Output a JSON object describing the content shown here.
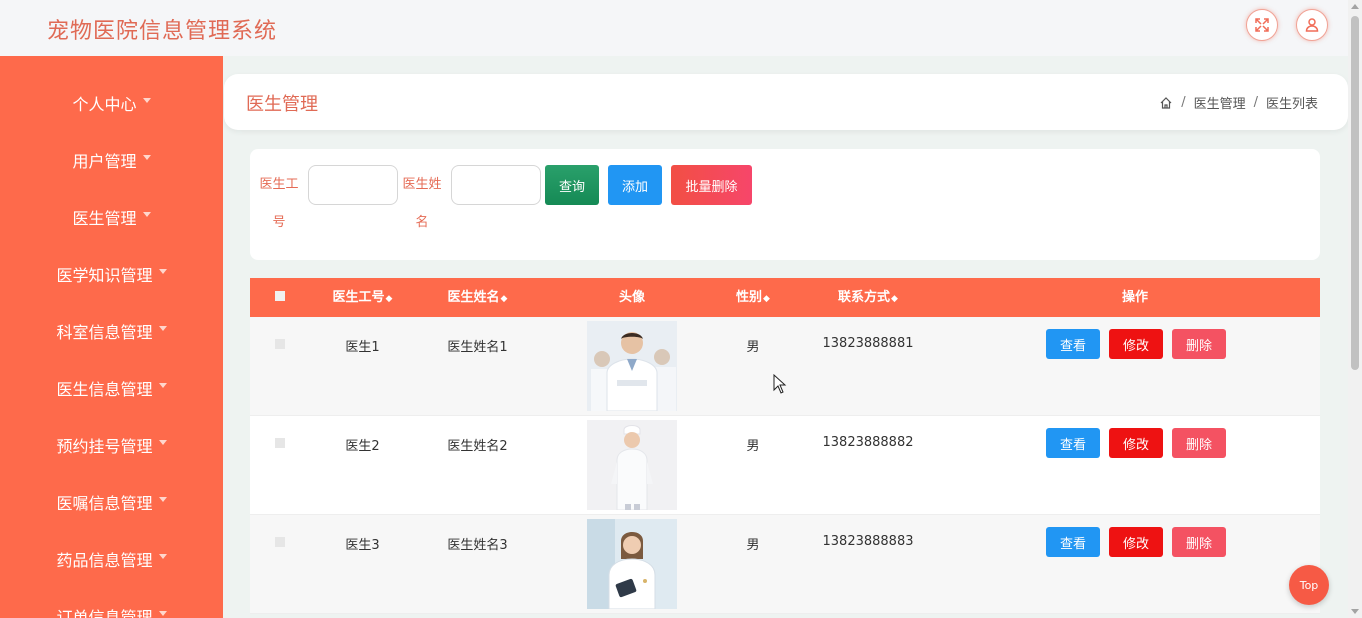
{
  "app": {
    "title": "宠物医院信息管理系统"
  },
  "topbar": {
    "fullscreen_icon": "fullscreen-icon",
    "user_icon": "user-icon"
  },
  "sidebar": {
    "items": [
      {
        "label": "个人中心"
      },
      {
        "label": "用户管理"
      },
      {
        "label": "医生管理"
      },
      {
        "label": "医学知识管理"
      },
      {
        "label": "科室信息管理"
      },
      {
        "label": "医生信息管理"
      },
      {
        "label": "预约挂号管理"
      },
      {
        "label": "医嘱信息管理"
      },
      {
        "label": "药品信息管理"
      },
      {
        "label": "订单信息管理"
      }
    ]
  },
  "header": {
    "title": "医生管理",
    "breadcrumb": [
      "医生管理",
      "医生列表"
    ],
    "breadcrumb_sep": "/"
  },
  "search": {
    "field1_label": "医生工号",
    "field1_value": "",
    "field2_label": "医生姓名",
    "field2_value": "",
    "query_label": "查询",
    "add_label": "添加",
    "bulk_delete_label": "批量删除"
  },
  "table": {
    "columns": [
      "医生工号",
      "医生姓名",
      "头像",
      "性别",
      "联系方式",
      "操作"
    ],
    "sort_glyph": "◆",
    "rows": [
      {
        "id": "医生1",
        "name": "医生姓名1",
        "gender": "男",
        "phone": "13823888881"
      },
      {
        "id": "医生2",
        "name": "医生姓名2",
        "gender": "男",
        "phone": "13823888882"
      },
      {
        "id": "医生3",
        "name": "医生姓名3",
        "gender": "男",
        "phone": "13823888883"
      }
    ],
    "actions": {
      "view": "查看",
      "edit": "修改",
      "delete": "删除"
    }
  },
  "back_to_top": "Top",
  "colors": {
    "accent": "#fe6a4b",
    "title": "#e06a55",
    "blue": "#2196f3",
    "green": "#158a55",
    "red": "#ee1212"
  }
}
